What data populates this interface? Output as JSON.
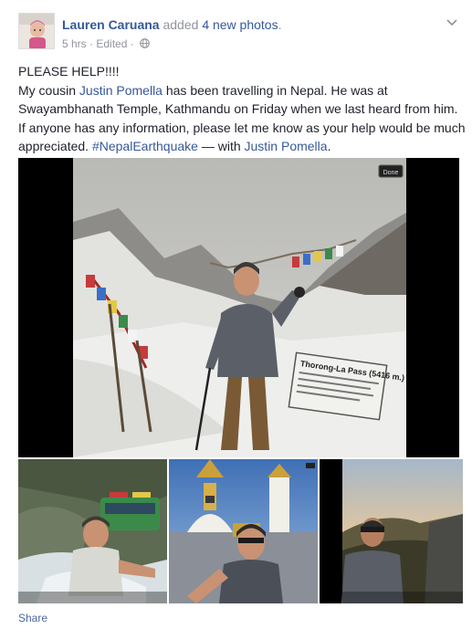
{
  "post": {
    "author": "Lauren Caruana",
    "action": "added",
    "count_text": "4 new photos",
    "period": ".",
    "time": "5 hrs",
    "sep1": "·",
    "edited": "Edited",
    "sep2": "·",
    "text_line1": "PLEASE HELP!!!!",
    "text_prefix": "My cousin ",
    "mention1": "Justin Pomella",
    "text_body": " has been travelling in Nepal. He was at Swayambhanath Temple, Kathmandu on Friday when we last heard from him. If anyone has any information, please let me know as your help would be much appreciated. ",
    "hashtag": "#NepalEarthquake",
    "with_text": " — with ",
    "mention2": "Justin Pomella",
    "text_end": "."
  },
  "photo_main": {
    "done_label": "Done",
    "sign_title": "Thorong-La Pass (5416 m.)"
  },
  "footer": {
    "share_label": "Share"
  },
  "icons": {
    "globe": "globe-icon",
    "chevron": "chevron-down-icon"
  },
  "colors": {
    "link": "#365899",
    "meta": "#90949c",
    "text": "#1d2129"
  }
}
